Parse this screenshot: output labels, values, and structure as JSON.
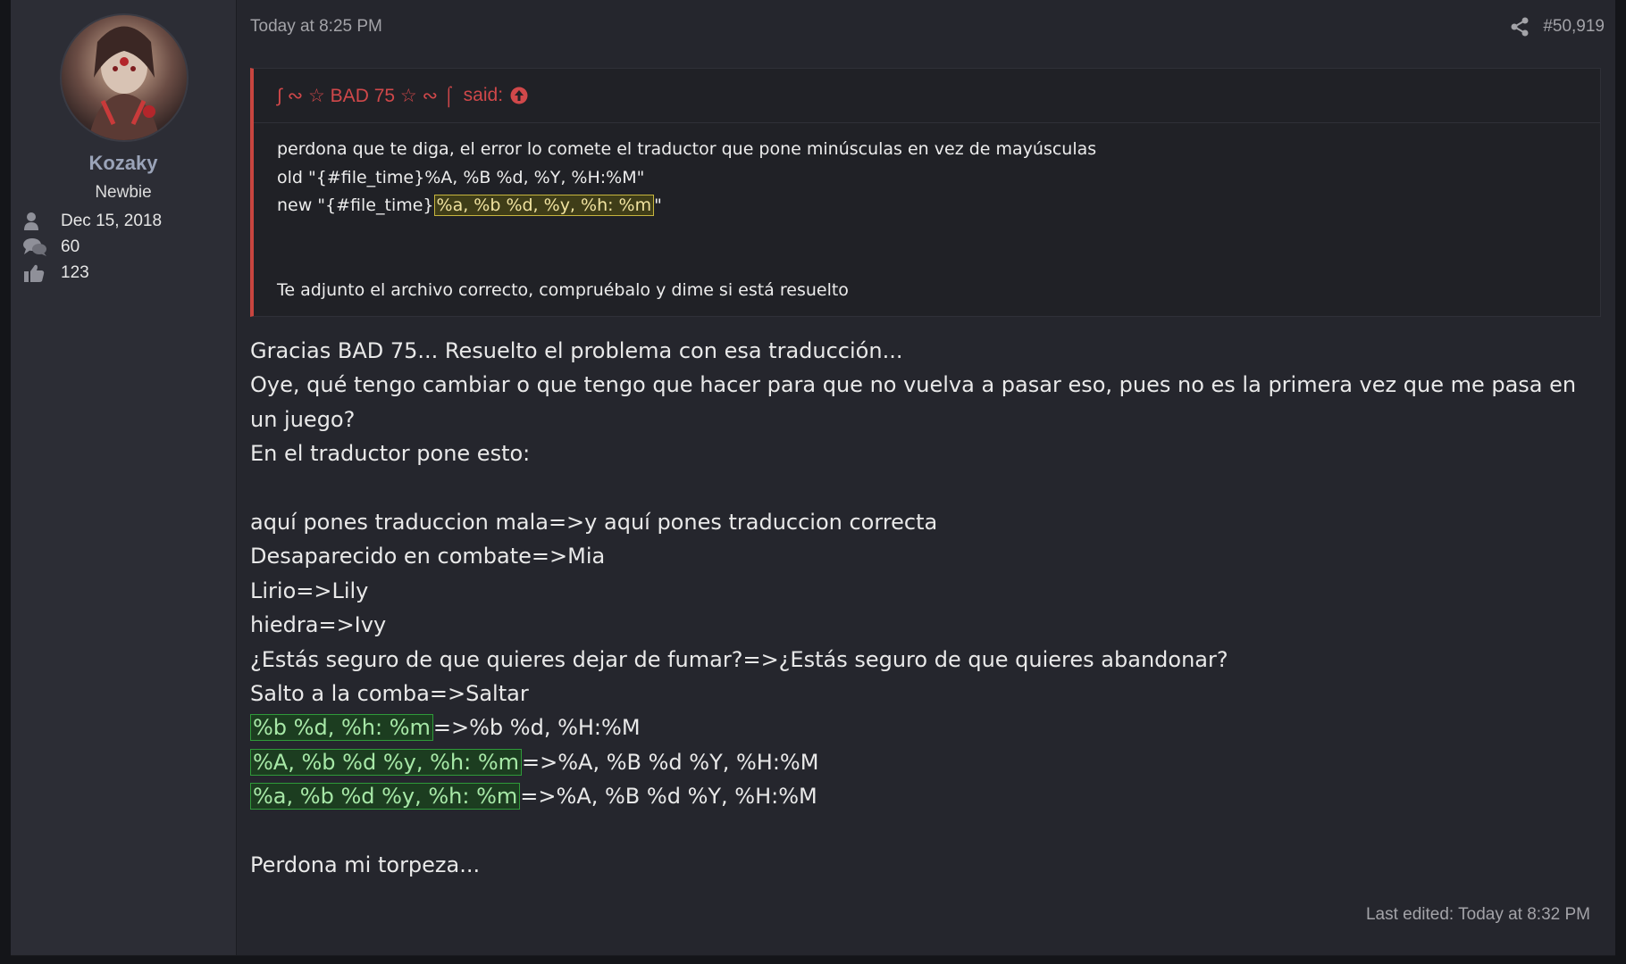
{
  "user": {
    "name": "Kozaky",
    "title": "Newbie",
    "joined": "Dec 15, 2018",
    "messages": "60",
    "reactions": "123"
  },
  "post": {
    "date": "Today at 8:25 PM",
    "number": "#50,919",
    "last_edited": "Last edited: Today at 8:32 PM"
  },
  "quote": {
    "author": "∫ ∾ ☆ BAD 75 ☆ ∾ ⌠",
    "said": "said:",
    "line1": "perdona que te diga, el error lo comete el traductor que pone minúsculas en vez de mayúsculas",
    "line2": "old \"{#file_time}%A, %B %d, %Y, %H:%M\"",
    "line3_prefix": "new \"{#file_time}",
    "line3_highlight": "%a, %b %d, %y, %h: %m",
    "line3_suffix": "\"",
    "line4": "Te adjunto el archivo correcto, compruébalo y dime si está resuelto"
  },
  "content": {
    "l1": "Gracias BAD 75... Resuelto el problema con esa traducción...",
    "l2": "Oye, qué tengo cambiar o que tengo que hacer para que no vuelva a pasar eso, pues no es la primera vez que me pasa en un juego?",
    "l3": "En el traductor pone esto:",
    "l4": "aquí pones traduccion mala=>y aquí pones traduccion correcta",
    "l5": "Desaparecido en combate=>Mia",
    "l6": "Lirio=>Lily",
    "l7": "hiedra=>Ivy",
    "l8": "¿Estás seguro de que quieres dejar de fumar?=>¿Estás seguro de que quieres abandonar?",
    "l9": "Salto a la comba=>Saltar",
    "l10_hl": "%b %d, %h: %m",
    "l10_rest": "=>%b %d, %H:%M",
    "l11_hl": "%A, %b %d %y, %h: %m",
    "l11_rest": "=>%A, %B %d %Y, %H:%M",
    "l12_hl": "%a, %b %d %y, %h: %m",
    "l12_rest": "=>%A, %B %d %Y, %H:%M",
    "l13": "Perdona mi torpeza..."
  },
  "icons": {
    "joined": "user-icon",
    "messages": "comments-icon",
    "reactions": "thumbs-up-icon",
    "share": "share-icon",
    "quote_jump": "arrow-up-circle-icon"
  },
  "colors": {
    "quote_accent": "#c8453f",
    "username": "#9aa3b8",
    "highlight_green": "#2f9a3a",
    "highlight_yellow": "#c7b53f"
  }
}
